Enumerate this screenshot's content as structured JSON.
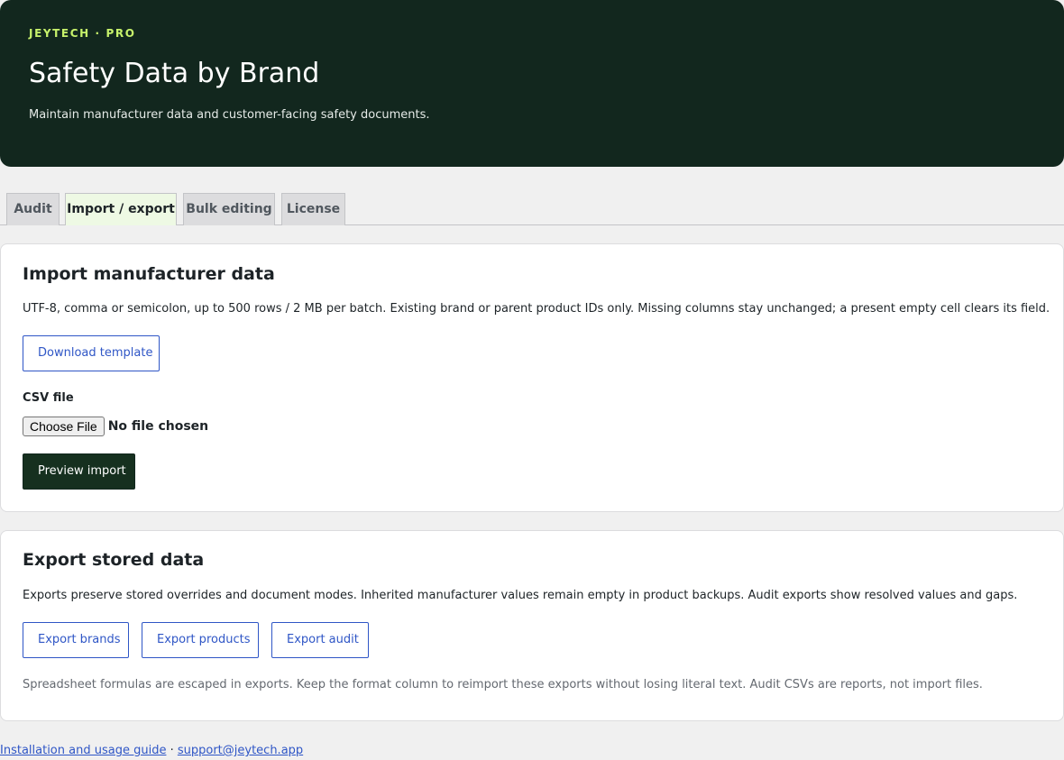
{
  "header": {
    "eyebrow": "JEYTECH · PRO",
    "title": "Safety Data by Brand",
    "subtitle": "Maintain manufacturer data and customer-facing safety documents."
  },
  "tabs": [
    {
      "label": "Audit",
      "active": false
    },
    {
      "label": "Import / export",
      "active": true
    },
    {
      "label": "Bulk editing",
      "active": false
    },
    {
      "label": "License",
      "active": false
    }
  ],
  "import_section": {
    "title": "Import manufacturer data",
    "description": "UTF-8, comma or semicolon, up to 500 rows / 2 MB per batch. Existing brand or parent product IDs only. Missing columns stay unchanged; a present empty cell clears its field.",
    "download_template_label": "Download template",
    "csv_file_label": "CSV file",
    "choose_file_label": "Choose File",
    "file_status": "No file chosen",
    "preview_button_label": "Preview import"
  },
  "export_section": {
    "title": "Export stored data",
    "description": "Exports preserve stored overrides and document modes. Inherited manufacturer values remain empty in product backups. Audit exports show resolved values and gaps.",
    "buttons": [
      {
        "label": "Export brands"
      },
      {
        "label": "Export products"
      },
      {
        "label": "Export audit"
      }
    ],
    "note": "Spreadsheet formulas are escaped in exports. Keep the format column to reimport these exports without losing literal text. Audit CSVs are reports, not import files."
  },
  "footer": {
    "guide_link": "Installation and usage guide",
    "separator": "·",
    "support_link": "support@jeytech.app"
  },
  "colors": {
    "hero_bg": "#12271e",
    "eyebrow": "#c7f26b",
    "link_blue": "#2f56c6",
    "primary_button": "#16301f",
    "active_tab_bg": "#eef9e4",
    "page_bg": "#f0f0f0"
  }
}
